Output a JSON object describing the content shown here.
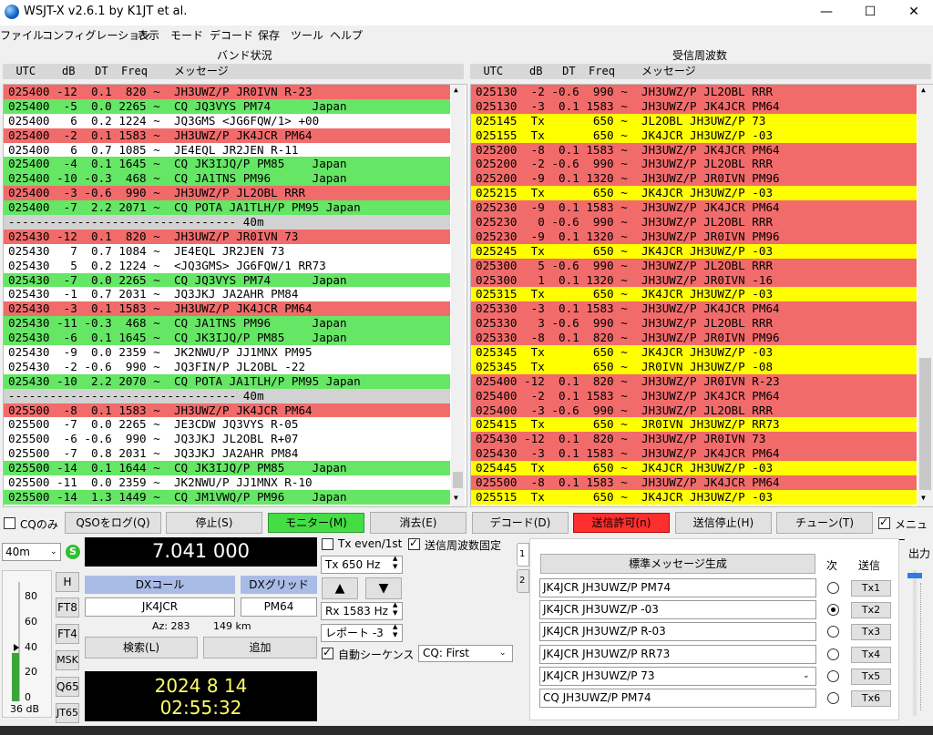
{
  "window": {
    "title": "WSJT-X   v2.6.1   by K1JT et al.",
    "minimize": "—",
    "maximize": "☐",
    "close": "✕"
  },
  "menu": [
    "ファイル",
    "コンフィグレーション",
    "表示",
    "モード",
    "デコード",
    "保存",
    "ツール",
    "ヘルプ"
  ],
  "band_activity": {
    "title": "バンド状況",
    "header": "  UTC    dB   DT  Freq    メッセージ",
    "rows": [
      {
        "text": "025400 -12  0.1  820 ~  JH3UWZ/P JR0IVN R-23",
        "color": "red"
      },
      {
        "text": "025400  -5  0.0 2265 ~  CQ JQ3VYS PM74      Japan",
        "color": "green"
      },
      {
        "text": "025400   6  0.2 1224 ~  JQ3GMS <JG6FQW/1> +00",
        "color": "white"
      },
      {
        "text": "025400  -2  0.1 1583 ~  JH3UWZ/P JK4JCR PM64",
        "color": "red"
      },
      {
        "text": "025400   6  0.7 1085 ~  JE4EQL JR2JEN R-11",
        "color": "white"
      },
      {
        "text": "025400  -4  0.1 1645 ~  CQ JK3IJQ/P PM85    Japan",
        "color": "green"
      },
      {
        "text": "025400 -10 -0.3  468 ~  CQ JA1TNS PM96      Japan",
        "color": "green"
      },
      {
        "text": "025400  -3 -0.6  990 ~  JH3UWZ/P JL2OBL RRR",
        "color": "red"
      },
      {
        "text": "025400  -7  2.2 2071 ~  CQ POTA JA1TLH/P PM95 Japan",
        "color": "green"
      },
      {
        "text": "--------------------------------- 40m",
        "color": "sep"
      },
      {
        "text": "025430 -12  0.1  820 ~  JH3UWZ/P JR0IVN 73",
        "color": "red"
      },
      {
        "text": "025430   7  0.7 1084 ~  JE4EQL JR2JEN 73",
        "color": "white"
      },
      {
        "text": "025430   5  0.2 1224 ~  <JQ3GMS> JG6FQW/1 RR73",
        "color": "white"
      },
      {
        "text": "025430  -7  0.0 2265 ~  CQ JQ3VYS PM74      Japan",
        "color": "green"
      },
      {
        "text": "025430  -1  0.7 2031 ~  JQ3JKJ JA2AHR PM84",
        "color": "white"
      },
      {
        "text": "025430  -3  0.1 1583 ~  JH3UWZ/P JK4JCR PM64",
        "color": "red"
      },
      {
        "text": "025430 -11 -0.3  468 ~  CQ JA1TNS PM96      Japan",
        "color": "green"
      },
      {
        "text": "025430  -6  0.1 1645 ~  CQ JK3IJQ/P PM85    Japan",
        "color": "green"
      },
      {
        "text": "025430  -9  0.0 2359 ~  JK2NWU/P JJ1MNX PM95",
        "color": "white"
      },
      {
        "text": "025430  -2 -0.6  990 ~  JQ3FIN/P JL2OBL -22",
        "color": "white"
      },
      {
        "text": "025430 -10  2.2 2070 ~  CQ POTA JA1TLH/P PM95 Japan",
        "color": "green"
      },
      {
        "text": "--------------------------------- 40m",
        "color": "sep"
      },
      {
        "text": "025500  -8  0.1 1583 ~  JH3UWZ/P JK4JCR PM64",
        "color": "red"
      },
      {
        "text": "025500  -7  0.0 2265 ~  JE3CDW JQ3VYS R-05",
        "color": "white"
      },
      {
        "text": "025500  -6 -0.6  990 ~  JQ3JKJ JL2OBL R+07",
        "color": "white"
      },
      {
        "text": "025500  -7  0.8 2031 ~  JQ3JKJ JA2AHR PM84",
        "color": "white"
      },
      {
        "text": "025500 -14  0.1 1644 ~  CQ JK3IJQ/P PM85    Japan",
        "color": "green"
      },
      {
        "text": "025500 -11  0.0 2359 ~  JK2NWU/P JJ1MNX R-10",
        "color": "white"
      },
      {
        "text": "025500 -14  1.3 1449 ~  CQ JM1VWQ/P PM96    Japan",
        "color": "green"
      }
    ]
  },
  "rx_frequency": {
    "title": "受信周波数",
    "header": "  UTC    dB   DT  Freq    メッセージ",
    "rows": [
      {
        "text": "025130  -2 -0.6  990 ~  JH3UWZ/P JL2OBL RRR",
        "color": "red"
      },
      {
        "text": "025130  -3  0.1 1583 ~  JH3UWZ/P JK4JCR PM64",
        "color": "red"
      },
      {
        "text": "025145  Tx       650 ~  JL2OBL JH3UWZ/P 73",
        "color": "yellow"
      },
      {
        "text": "025155  Tx       650 ~  JK4JCR JH3UWZ/P -03",
        "color": "yellow"
      },
      {
        "text": "025200  -8  0.1 1583 ~  JH3UWZ/P JK4JCR PM64",
        "color": "red"
      },
      {
        "text": "025200  -2 -0.6  990 ~  JH3UWZ/P JL2OBL RRR",
        "color": "red"
      },
      {
        "text": "025200  -9  0.1 1320 ~  JH3UWZ/P JR0IVN PM96",
        "color": "red"
      },
      {
        "text": "025215  Tx       650 ~  JK4JCR JH3UWZ/P -03",
        "color": "yellow"
      },
      {
        "text": "025230  -9  0.1 1583 ~  JH3UWZ/P JK4JCR PM64",
        "color": "red"
      },
      {
        "text": "025230   0 -0.6  990 ~  JH3UWZ/P JL2OBL RRR",
        "color": "red"
      },
      {
        "text": "025230  -9  0.1 1320 ~  JH3UWZ/P JR0IVN PM96",
        "color": "red"
      },
      {
        "text": "025245  Tx       650 ~  JK4JCR JH3UWZ/P -03",
        "color": "yellow"
      },
      {
        "text": "025300   5 -0.6  990 ~  JH3UWZ/P JL2OBL RRR",
        "color": "red"
      },
      {
        "text": "025300   1  0.1 1320 ~  JH3UWZ/P JR0IVN -16",
        "color": "red"
      },
      {
        "text": "025315  Tx       650 ~  JK4JCR JH3UWZ/P -03",
        "color": "yellow"
      },
      {
        "text": "025330  -3  0.1 1583 ~  JH3UWZ/P JK4JCR PM64",
        "color": "red"
      },
      {
        "text": "025330   3 -0.6  990 ~  JH3UWZ/P JL2OBL RRR",
        "color": "red"
      },
      {
        "text": "025330  -8  0.1  820 ~  JH3UWZ/P JR0IVN PM96",
        "color": "red"
      },
      {
        "text": "025345  Tx       650 ~  JK4JCR JH3UWZ/P -03",
        "color": "yellow"
      },
      {
        "text": "025345  Tx       650 ~  JR0IVN JH3UWZ/P -08",
        "color": "yellow"
      },
      {
        "text": "025400 -12  0.1  820 ~  JH3UWZ/P JR0IVN R-23",
        "color": "red"
      },
      {
        "text": "025400  -2  0.1 1583 ~  JH3UWZ/P JK4JCR PM64",
        "color": "red"
      },
      {
        "text": "025400  -3 -0.6  990 ~  JH3UWZ/P JL2OBL RRR",
        "color": "red"
      },
      {
        "text": "025415  Tx       650 ~  JR0IVN JH3UWZ/P RR73",
        "color": "yellow"
      },
      {
        "text": "025430 -12  0.1  820 ~  JH3UWZ/P JR0IVN 73",
        "color": "red"
      },
      {
        "text": "025430  -3  0.1 1583 ~  JH3UWZ/P JK4JCR PM64",
        "color": "red"
      },
      {
        "text": "025445  Tx       650 ~  JK4JCR JH3UWZ/P -03",
        "color": "yellow"
      },
      {
        "text": "025500  -8  0.1 1583 ~  JH3UWZ/P JK4JCR PM64",
        "color": "red"
      },
      {
        "text": "025515  Tx       650 ~  JK4JCR JH3UWZ/P -03",
        "color": "yellow"
      }
    ]
  },
  "controls": {
    "cq_only": "CQのみ",
    "log_qso": "QSOをログ(Q)",
    "stop": "停止(S)",
    "monitor": "モニター(M)",
    "erase": "消去(E)",
    "decode": "デコード(D)",
    "enable_tx": "送信許可(n)",
    "halt_tx": "送信停止(H)",
    "tune": "チューン(T)",
    "menu_label": "メニュー"
  },
  "radio": {
    "band": "40m",
    "freq": "7.041 000",
    "s_label": "S",
    "dx_call_label": "DXコール",
    "dx_grid_label": "DXグリッド",
    "dx_call": "JK4JCR",
    "dx_grid": "PM64",
    "az": "Az: 283",
    "dist": "149 km",
    "lookup": "検索(L)",
    "add": "追加",
    "date": "2024 8 14",
    "time": "02:55:32"
  },
  "modes": [
    "H",
    "FT8",
    "FT4",
    "MSK",
    "Q65",
    "JT65"
  ],
  "meter": {
    "ticks": [
      "80",
      "60",
      "40",
      "20",
      "0"
    ],
    "level_db": "36 dB",
    "level": 36
  },
  "tx_opts": {
    "tx_even": "Tx even/1st",
    "hold_tx": "送信周波数固定",
    "tx_freq": "Tx  650  Hz",
    "rx_freq": "Rx  1583  Hz",
    "report": "レポート -3",
    "auto_seq": "自動シーケンス",
    "cq_sel": "CQ: First",
    "up": "▲",
    "down": "▼"
  },
  "tx_messages": {
    "tabs": [
      "1",
      "2"
    ],
    "gen_btn": "標準メッセージ生成",
    "next_label": "次",
    "send_label": "送信",
    "msgs": [
      {
        "text": "JK4JCR JH3UWZ/P PM74",
        "btn": "Tx1"
      },
      {
        "text": "JK4JCR JH3UWZ/P -03",
        "btn": "Tx2"
      },
      {
        "text": "JK4JCR JH3UWZ/P R-03",
        "btn": "Tx3"
      },
      {
        "text": "JK4JCR JH3UWZ/P RR73",
        "btn": "Tx4"
      },
      {
        "text": "JK4JCR JH3UWZ/P 73",
        "btn": "Tx5"
      },
      {
        "text": "CQ JH3UWZ/P PM74",
        "btn": "Tx6"
      }
    ],
    "selected_next": 2
  },
  "output_label": "出力",
  "colors": {
    "red": "#f26b6b",
    "green": "#65e665",
    "yellow": "#ffff00",
    "monitor": "#44dd44",
    "enable_tx": "#ff2e2e",
    "display_bg": "#000000",
    "freq_fg": "#ffffff",
    "clock_fg": "#ffff66"
  }
}
